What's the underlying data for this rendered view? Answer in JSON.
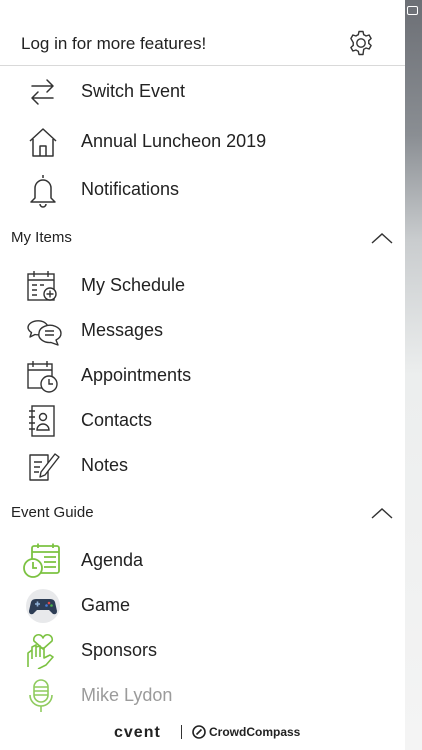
{
  "header": {
    "login_text": "Log in for more features!",
    "settings_icon": "gear-icon"
  },
  "top_items": [
    {
      "label": "Switch Event",
      "icon": "swap-arrows-icon"
    },
    {
      "label": "Annual Luncheon 2019",
      "icon": "home-icon"
    },
    {
      "label": "Notifications",
      "icon": "bell-icon"
    }
  ],
  "my_items": {
    "title": "My Items",
    "expanded": true,
    "items": [
      {
        "label": "My Schedule",
        "icon": "calendar-add-icon"
      },
      {
        "label": "Messages",
        "icon": "chat-bubbles-icon"
      },
      {
        "label": "Appointments",
        "icon": "calendar-clock-icon"
      },
      {
        "label": "Contacts",
        "icon": "contact-book-icon"
      },
      {
        "label": "Notes",
        "icon": "note-pencil-icon"
      }
    ]
  },
  "event_guide": {
    "title": "Event Guide",
    "expanded": true,
    "items": [
      {
        "label": "Agenda",
        "icon": "agenda-icon"
      },
      {
        "label": "Game",
        "icon": "gamepad-icon"
      },
      {
        "label": "Sponsors",
        "icon": "heart-hand-icon"
      },
      {
        "label": "Mike Lydon",
        "icon": "microphone-icon"
      }
    ]
  },
  "footer": {
    "brand_left": "cvent",
    "brand_right": "CrowdCompass"
  },
  "colors": {
    "accent_green": "#7cc242",
    "text": "#222222",
    "divider": "#d9d9d9",
    "muted": "#9b9b9b"
  }
}
